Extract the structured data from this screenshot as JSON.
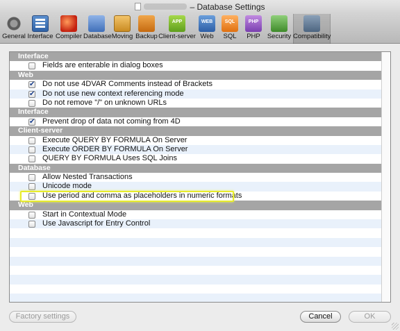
{
  "window": {
    "title": "– Database Settings"
  },
  "toolbar": {
    "items": [
      {
        "label": "General",
        "icon": "general-icon"
      },
      {
        "label": "Interface",
        "icon": "interface-icon"
      },
      {
        "label": "Compiler",
        "icon": "compiler-icon"
      },
      {
        "label": "Database",
        "icon": "database-icon"
      },
      {
        "label": "Moving",
        "icon": "moving-icon"
      },
      {
        "label": "Backup",
        "icon": "backup-icon"
      },
      {
        "label": "Client-server",
        "icon": "client-server-icon",
        "badge": "APP"
      },
      {
        "label": "Web",
        "icon": "web-icon",
        "badge": "WEB"
      },
      {
        "label": "SQL",
        "icon": "sql-icon",
        "badge": "SQL"
      },
      {
        "label": "PHP",
        "icon": "php-icon",
        "badge": "PHP"
      },
      {
        "label": "Security",
        "icon": "security-icon"
      },
      {
        "label": "Compatibility",
        "icon": "compatibility-icon",
        "active": true
      }
    ]
  },
  "sections": [
    {
      "header": "Interface",
      "items": [
        {
          "label": "Fields are enterable in dialog boxes",
          "checked": false
        }
      ]
    },
    {
      "header": "Web",
      "items": [
        {
          "label": "Do not use 4DVAR Comments instead of Brackets",
          "checked": true
        },
        {
          "label": "Do not use new context referencing mode",
          "checked": true
        },
        {
          "label": "Do not remove \"/\" on unknown URLs",
          "checked": false
        }
      ]
    },
    {
      "header": "Interface",
      "items": [
        {
          "label": "Prevent drop of data not coming from 4D",
          "checked": true
        }
      ]
    },
    {
      "header": "Client-server",
      "items": [
        {
          "label": "Execute QUERY BY FORMULA On Server",
          "checked": false
        },
        {
          "label": "Execute ORDER BY FORMULA On Server",
          "checked": false
        },
        {
          "label": "QUERY BY FORMULA Uses SQL Joins",
          "checked": false
        }
      ]
    },
    {
      "header": "Database",
      "items": [
        {
          "label": "Allow Nested Transactions",
          "checked": false
        },
        {
          "label": "Unicode mode",
          "checked": false
        },
        {
          "label": "Use period and comma as placeholders in numeric formats",
          "checked": false
        }
      ]
    },
    {
      "header": "Web",
      "items": [
        {
          "label": "Start in Contextual Mode",
          "checked": false
        },
        {
          "label": "Use Javascript for Entry Control",
          "checked": false
        }
      ]
    }
  ],
  "buttons": {
    "factory": "Factory settings",
    "cancel": "Cancel",
    "ok": "OK"
  },
  "colors": {
    "highlight": "#e8ec2c",
    "header_bg": "#a5a5a5",
    "stripe": "#e9f1fb"
  }
}
